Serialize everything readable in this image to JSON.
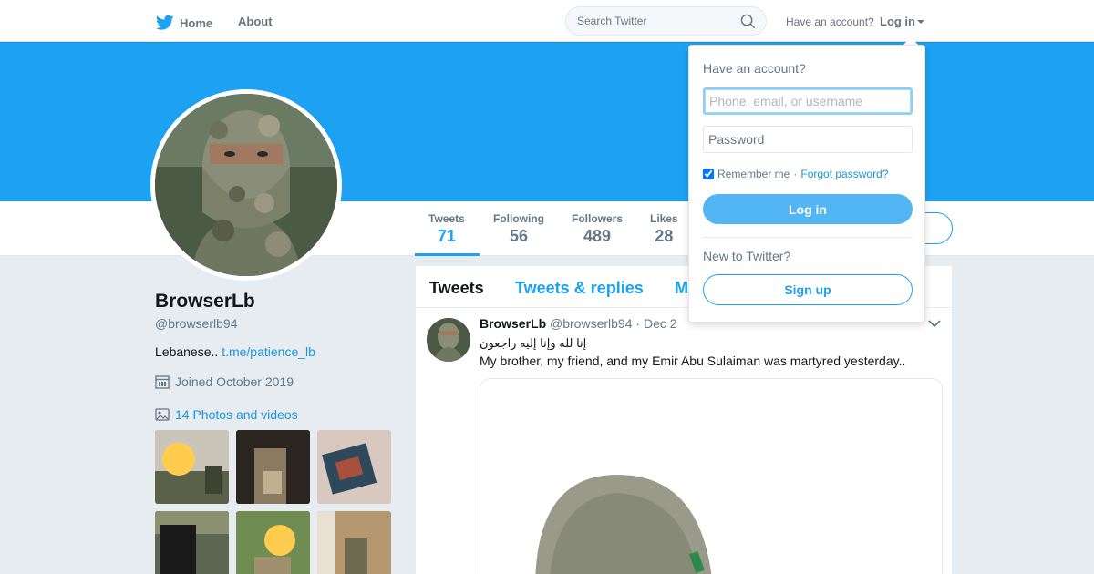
{
  "nav": {
    "home_label": "Home",
    "about_label": "About",
    "search_placeholder": "Search Twitter",
    "have_account": "Have an account?",
    "login_label": "Log in",
    "brand_color": "#1da1f2"
  },
  "profile": {
    "name": "BrowserLb",
    "handle": "@browserlb94",
    "bio_text": "Lebanese..",
    "bio_link": "t.me/patience_lb",
    "joined": "Joined October 2019",
    "photos_label": "14 Photos and videos"
  },
  "stats": [
    {
      "label": "Tweets",
      "value": "71"
    },
    {
      "label": "Following",
      "value": "56"
    },
    {
      "label": "Followers",
      "value": "489"
    },
    {
      "label": "Likes",
      "value": "28"
    }
  ],
  "timeline": {
    "tabs": [
      "Tweets",
      "Tweets & replies",
      "M"
    ]
  },
  "tweet": {
    "name": "BrowserLb",
    "handle": "@browserlb94",
    "separator": "·",
    "date": "Dec 2",
    "arabic": "إنا لله وإنا إليه راجعون",
    "text": "My brother, my friend, and my Emir Abu Sulaiman was martyred yesterday.."
  },
  "login_dropdown": {
    "title": "Have an account?",
    "username_placeholder": "Phone, email, or username",
    "password_placeholder": "Password",
    "remember_label": "Remember me",
    "separator": "·",
    "forgot_label": "Forgot password?",
    "login_button": "Log in",
    "new_label": "New to Twitter?",
    "signup_button": "Sign up"
  }
}
